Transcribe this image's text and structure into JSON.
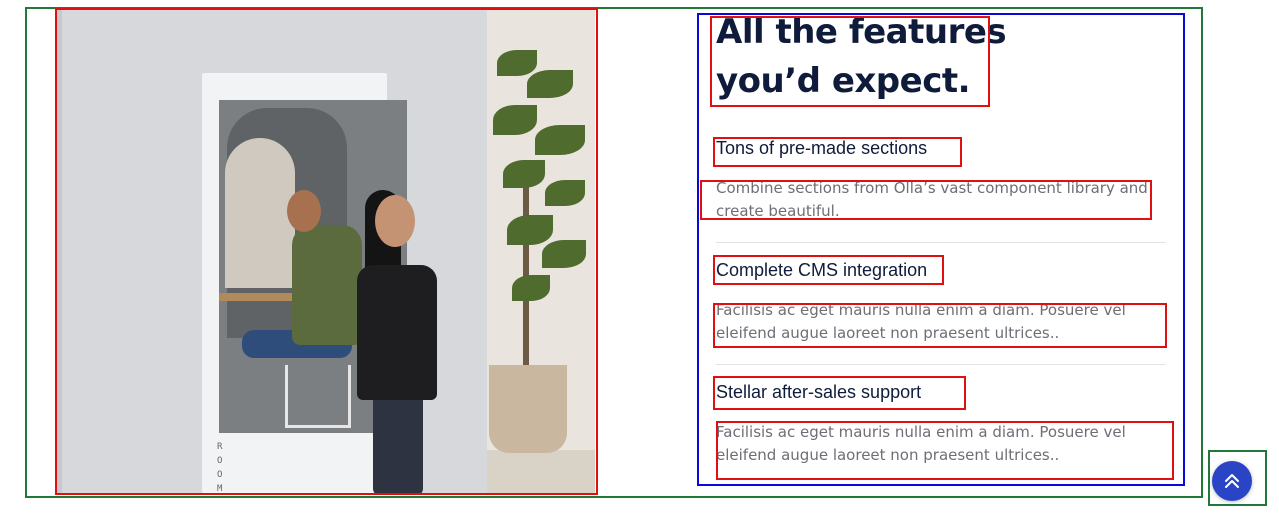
{
  "section": {
    "heading_line1": "All the features",
    "heading_line2": "you’d expect.",
    "features": [
      {
        "title": "Tons of pre-made sections",
        "description": "Combine sections from Olla’s vast component library and create beautiful."
      },
      {
        "title": "Complete CMS integration",
        "description": "Facilisis ac eget mauris nulla enim a diam. Posuere vel eleifend augue laoreet non praesent ultrices.."
      },
      {
        "title": "Stellar after-sales support",
        "description": "Facilisis ac eget mauris nulla enim a diam. Posuere vel eleifend augue laoreet non praesent ultrices.."
      }
    ]
  },
  "image": {
    "room_mark": "R O O M"
  },
  "colors": {
    "accent": "#2a44c6",
    "heading": "#0f1b3a",
    "body_text": "#6e6e76"
  },
  "icons": {
    "scroll_top": "double-chevron-up-icon"
  }
}
